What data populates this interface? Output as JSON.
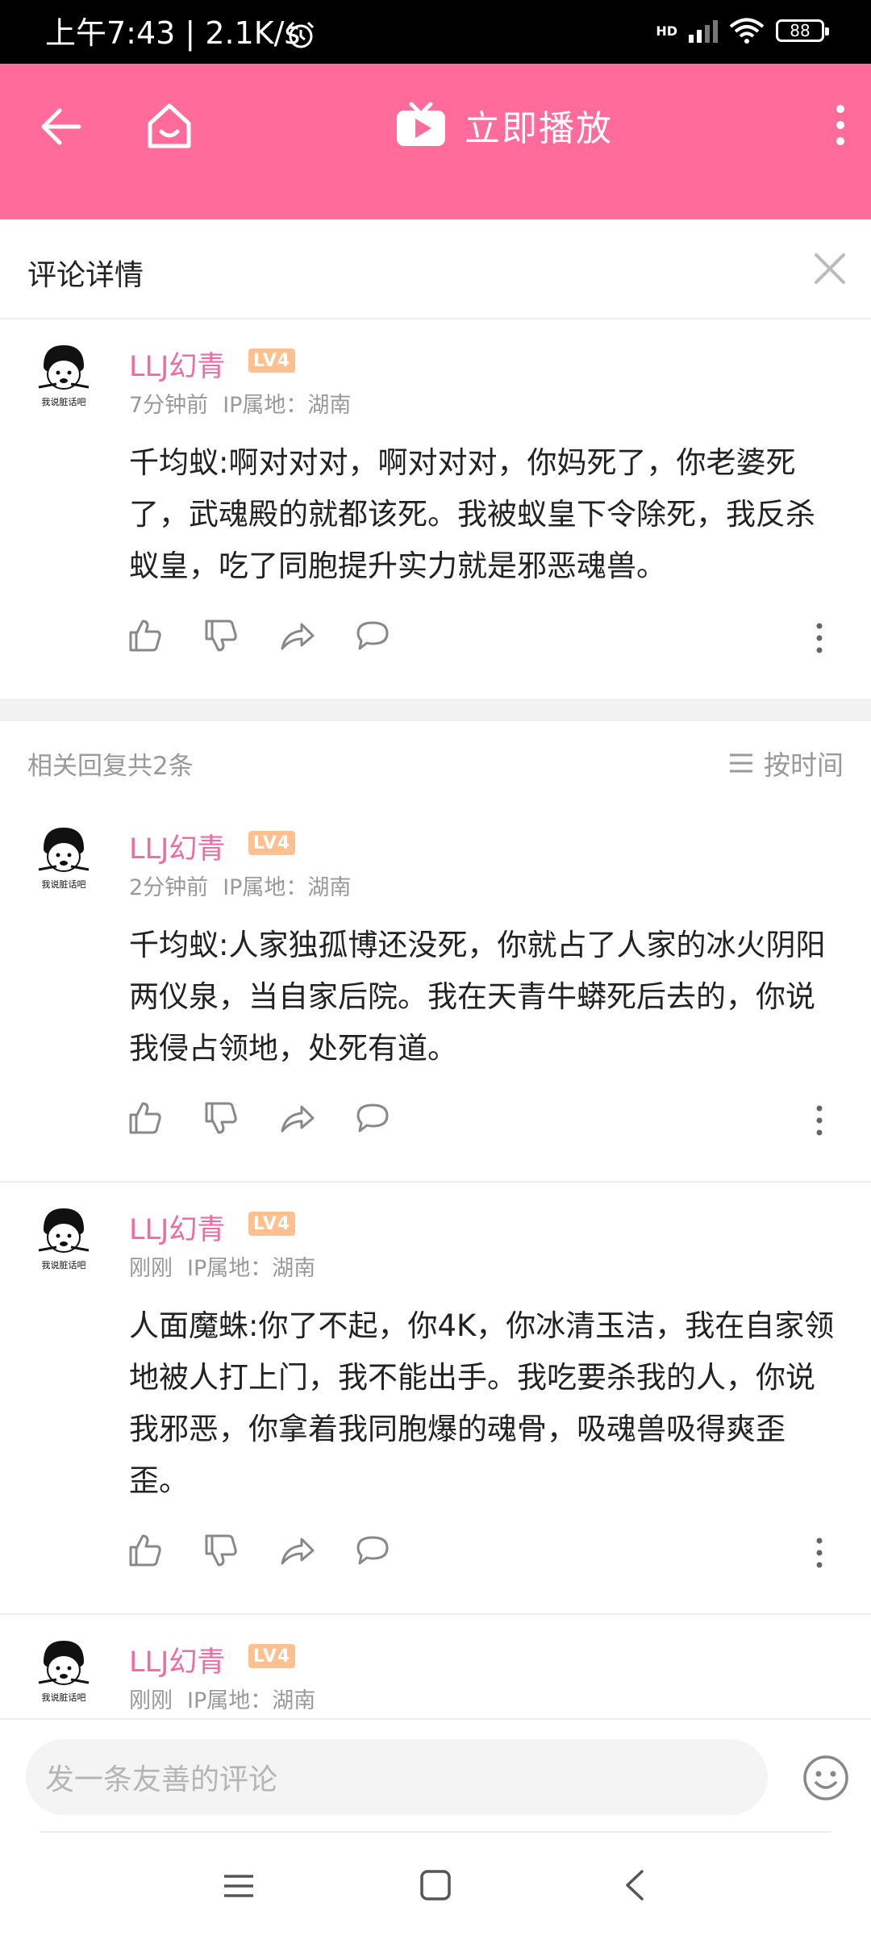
{
  "status_bar": {
    "time": "上午7:43",
    "speed": "2.1K/s",
    "network": "HD",
    "battery": "88"
  },
  "header": {
    "play_label": "立即播放",
    "accent_color": "#ff6c9b"
  },
  "detail": {
    "title": "评论详情"
  },
  "main_comment": {
    "user": "LLJ幻青",
    "level": "LV4",
    "time": "7分钟前",
    "ip": "IP属地：湖南",
    "text": "千均蚁:啊对对对，啊对对对，你妈死了，你老婆死了，武魂殿的就都该死。我被蚁皇下令除死，我反杀蚁皇，吃了同胞提升实力就是邪恶魂兽。"
  },
  "replies_header": {
    "count_label": "相关回复共2条",
    "sort_label": "按时间"
  },
  "replies": [
    {
      "user": "LLJ幻青",
      "level": "LV4",
      "time": "2分钟前",
      "ip": "IP属地：湖南",
      "text": "千均蚁:人家独孤博还没死，你就占了人家的冰火阴阳两仪泉，当自家后院。我在天青牛蟒死后去的，你说我侵占领地，处死有道。"
    },
    {
      "user": "LLJ幻青",
      "level": "LV4",
      "time": "刚刚",
      "ip": "IP属地：湖南",
      "text": "人面魔蛛:你了不起，你4K，你冰清玉洁，我在自家领地被人打上门，我不能出手。我吃要杀我的人，你说我邪恶，你拿着我同胞爆的魂骨，吸魂兽吸得爽歪歪。"
    },
    {
      "user": "LLJ幻青",
      "level": "LV4",
      "time": "刚刚",
      "ip": "IP属地：湖南",
      "text": ""
    }
  ],
  "avatar_caption": "我说脏话吧",
  "input": {
    "placeholder": "发一条友善的评论"
  }
}
